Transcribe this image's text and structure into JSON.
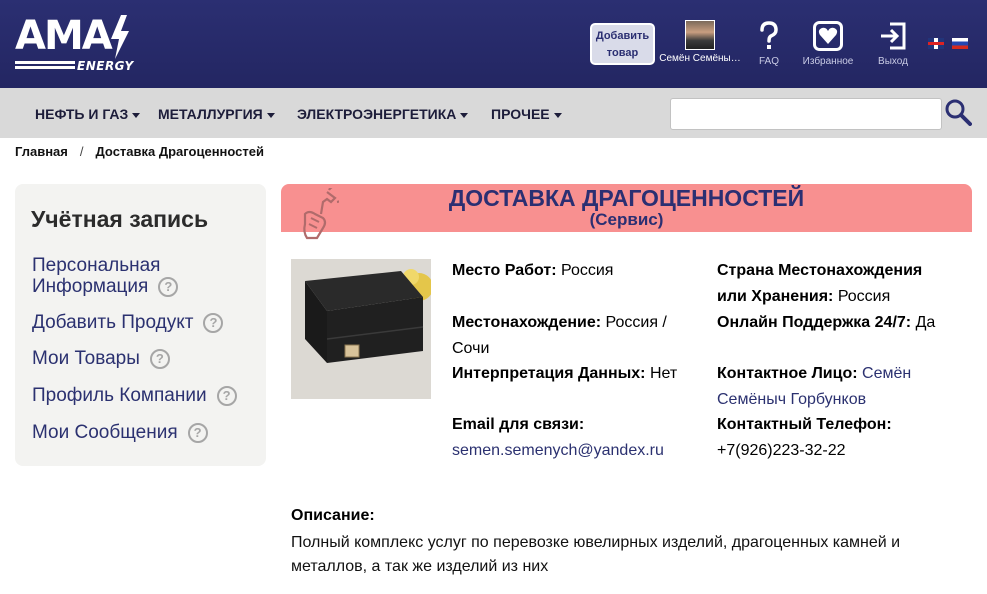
{
  "header": {
    "logo_text": "AMA",
    "logo_sub": "ENERGY",
    "add_product": "Добавить товар",
    "user_name": "Семён Семёны…",
    "faq": "FAQ",
    "favorites": "Избранное",
    "exit": "Выход",
    "icons": [
      "avatar",
      "question-icon",
      "heart-icon",
      "exit-icon",
      "flag-uk-icon",
      "flag-ru-icon"
    ]
  },
  "nav": {
    "items": [
      {
        "label": "НЕФТЬ И ГАЗ"
      },
      {
        "label": "МЕТАЛЛУРГИЯ"
      },
      {
        "label": "ЭЛЕКТРОЭНЕРГЕТИКА"
      },
      {
        "label": "ПРОЧЕЕ"
      }
    ],
    "search_value": ""
  },
  "breadcrumb": {
    "home": "Главная",
    "separator": "/",
    "current": "Доставка Драгоценностей"
  },
  "sidebar": {
    "title": "Учётная запись",
    "items": [
      {
        "label": "Персональная Информация",
        "label_line1": "Персональная",
        "label_line2": "Информация"
      },
      {
        "label": "Добавить Продукт"
      },
      {
        "label": "Мои Товары"
      },
      {
        "label": "Профиль Компании"
      },
      {
        "label": "Мои Сообщения"
      }
    ],
    "help_glyph": "?"
  },
  "listing": {
    "title": "ДОСТАВКА ДРАГОЦЕННОСТЕЙ",
    "subtitle": "(Сервис)",
    "title_bar_color": "#f89090",
    "fields": {
      "work_place_label": "Место Работ:",
      "work_place_value": "Россия",
      "location_label": "Местонахождение:",
      "location_value": "Россия / Сочи",
      "interpretation_label": "Интерпретация Данных:",
      "interpretation_value": "Нет",
      "email_label": "Email для связи:",
      "email_value": "semen.semenych@yandex.ru",
      "storage_country_label": "Страна Местонахождения или Хранения:",
      "storage_country_label_line1": "Страна Местонахождения",
      "storage_country_label_line2": "или Хранения:",
      "storage_country_value": "Россия",
      "support_label": "Онлайн Поддержка 24/7:",
      "support_value": "Да",
      "contact_label": "Контактное Лицо:",
      "contact_value": "Семён Семёныч Горбунков",
      "contact_value_line1": "Семён",
      "contact_value_line2": "Семёныч Горбунков",
      "phone_label": "Контактный Телефон:",
      "phone_value": "+7(926)223-32-22"
    },
    "description_label": "Описание:",
    "description": "Полный комплекс услуг по перевозке ювелирных изделий, драгоценных камней и металлов, а так же изделий из них"
  },
  "colors": {
    "header_bg": "#2b2f72",
    "nav_bg": "#d9d9d9",
    "link": "#2b3170",
    "title": "#2b2f72"
  }
}
